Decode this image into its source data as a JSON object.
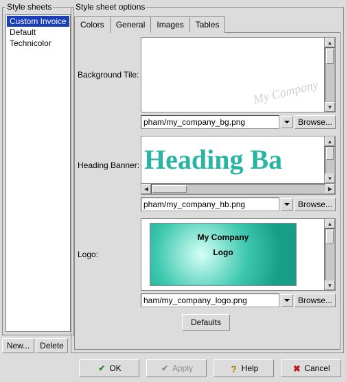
{
  "left": {
    "legend": "Style sheets",
    "items": [
      "Custom Invoice",
      "Default",
      "Technicolor"
    ],
    "selected_index": 0,
    "new_btn": "New...",
    "delete_btn": "Delete"
  },
  "right": {
    "legend": "Style sheet options",
    "tabs": [
      "Colors",
      "General",
      "Images",
      "Tables"
    ],
    "active_tab_index": 2,
    "images": {
      "bg": {
        "label": "Background Tile:",
        "path": "pham/my_company_bg.png",
        "browse": "Browse...",
        "faint_text": "My Company"
      },
      "hb": {
        "label": "Heading Banner:",
        "path": "pham/my_company_hb.png",
        "browse": "Browse...",
        "preview_text": "Heading Ba"
      },
      "logo": {
        "label": "Logo:",
        "path": "ham/my_company_logo.png",
        "browse": "Browse...",
        "line1": "My Company",
        "line2": "Logo"
      },
      "defaults": "Defaults"
    }
  },
  "buttons": {
    "ok": "OK",
    "apply": "Apply",
    "help": "Help",
    "cancel": "Cancel"
  }
}
